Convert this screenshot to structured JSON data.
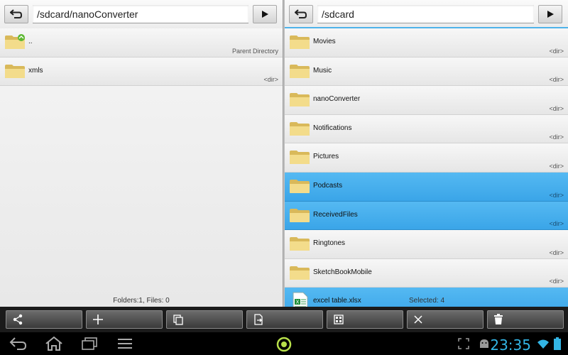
{
  "left": {
    "path": "/sdcard/nanoConverter",
    "items": [
      {
        "name": "..",
        "meta": "Parent Directory",
        "selected": false,
        "parent": true
      },
      {
        "name": "xmls",
        "meta": "<dir>",
        "selected": false,
        "parent": false
      }
    ],
    "status": "Folders:1, Files: 0"
  },
  "right": {
    "path": "/sdcard",
    "items": [
      {
        "name": "Movies",
        "meta": "<dir>",
        "selected": false
      },
      {
        "name": "Music",
        "meta": "<dir>",
        "selected": false
      },
      {
        "name": "nanoConverter",
        "meta": "<dir>",
        "selected": false
      },
      {
        "name": "Notifications",
        "meta": "<dir>",
        "selected": false
      },
      {
        "name": "Pictures",
        "meta": "<dir>",
        "selected": false
      },
      {
        "name": "Podcasts",
        "meta": "<dir>",
        "selected": true
      },
      {
        "name": "ReceivedFiles",
        "meta": "<dir>",
        "selected": true
      },
      {
        "name": "Ringtones",
        "meta": "<dir>",
        "selected": false
      },
      {
        "name": "SketchBookMobile",
        "meta": "<dir>",
        "selected": false
      },
      {
        "name": "excel table.xlsx",
        "meta": "",
        "selected": true
      }
    ],
    "status": "Selected: 4"
  },
  "toolbar": {
    "tools": [
      "share-icon",
      "plus-icon",
      "copy-icon",
      "move-icon",
      "select-grid-icon",
      "close-icon",
      "trash-icon"
    ]
  },
  "system": {
    "clock": "23:35",
    "accent": "#33b5e5"
  }
}
